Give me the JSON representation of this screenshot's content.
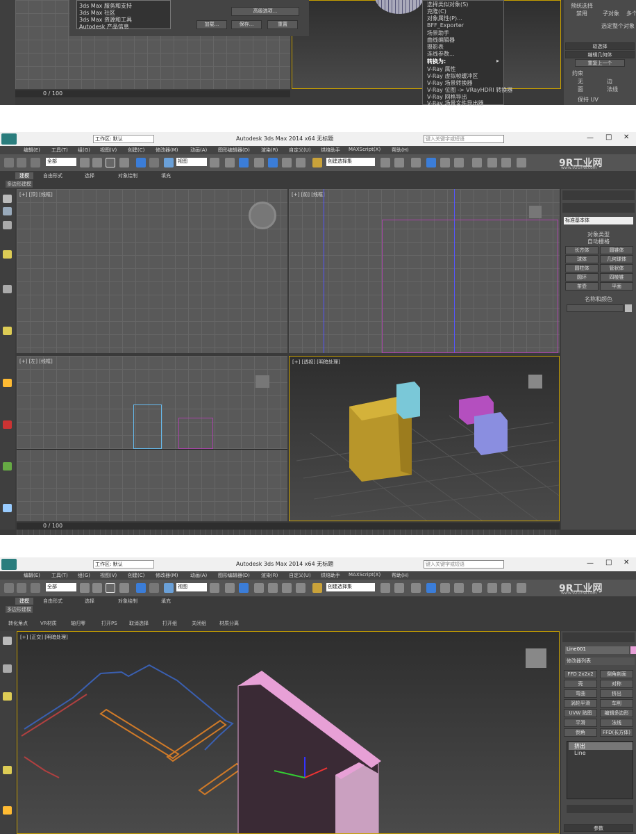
{
  "s1": {
    "dropdown_items": [
      "3ds Max 服务和支持",
      "3ds Max 社区",
      "3ds Max 资源和工具",
      "Autodesk 产品信息"
    ],
    "adv_option": "高级选项...",
    "load": "加载...",
    "save": "保存...",
    "reset": "重置",
    "context_items": [
      "选择类似对象(S)",
      "克隆(C)",
      "对象属性(P)...",
      "BFF_Exporter",
      "场景助手",
      "曲线编辑器",
      "摄影表",
      "连线参数...",
      "转换为:",
      "V-Ray 属性",
      "V-Ray 虚拟帧缓冲区",
      "V-Ray 场景转换器",
      "V-Ray 位图 -> VRayHDRI 转换器",
      "V-Ray 网格导出",
      "V-Ray 场景文件导出器"
    ],
    "preset_label": "预统选择",
    "radio_row": [
      "禁用",
      "子对象",
      "多个"
    ],
    "select_whole": "选定整个对象",
    "soft_select": "软选择",
    "edit_geom": "编辑几何体",
    "repeat_last": "重复上一个",
    "constraint": "约束",
    "constraint_opts": [
      "无",
      "边",
      "面",
      "法线"
    ],
    "keep_uv": "保持 UV",
    "timeline": "0 / 100"
  },
  "app": {
    "title": "Autodesk 3ds Max  2014 x64    无标题",
    "search_placeholder": "键入关键字或短语",
    "menus": [
      "编辑(E)",
      "工具(T)",
      "组(G)",
      "视图(V)",
      "创建(C)",
      "修改器(M)",
      "动画(A)",
      "图形编辑器(D)",
      "渲染(R)",
      "自定义(U)",
      "烘焙助手",
      "MAXScript(X)",
      "帮助(H)"
    ],
    "workspace": "工作区: 默认",
    "filter_all": "全部",
    "view_dd": "视图",
    "selset": "创建选择集",
    "watermark": "9R工业网",
    "watermark_url": "www.92GYW.com"
  },
  "s2": {
    "ribbon_tabs": [
      "建模",
      "自由形式",
      "选择",
      "对象绘制",
      "填充"
    ],
    "ribbon_sub": "多边形建模",
    "vp_top": "[+] [顶] [线框]",
    "vp_front": "[+] [前] [线框]",
    "vp_left": "[+] [左] [线框]",
    "vp_persp": "[+] [透视] [明暗处理]",
    "std_primitives": "标准基本体",
    "object_type": "对象类型",
    "autogrid": "自动栅格",
    "prims": [
      "长方体",
      "圆锥体",
      "球体",
      "几何球体",
      "圆柱体",
      "管状体",
      "圆环",
      "四棱锥",
      "茶壶",
      "平面"
    ],
    "name_color": "名称和颜色",
    "timeline": "0 / 100"
  },
  "s3": {
    "ribbon_tabs": [
      "建模",
      "自由形式",
      "选择",
      "对象绘制",
      "填充"
    ],
    "ribbon_sub": "多边形建模",
    "tools": [
      "转化角点",
      "VR材质",
      "轴归零",
      "打开PS",
      "取消选择",
      "打开组",
      "关闭组",
      "材质分离"
    ],
    "vp_label": "[+] [正交] [明暗处理]",
    "obj_name": "Line001",
    "modlist": "修改器列表",
    "mods": [
      "FFD 2x2x2",
      "倒角剖面",
      "壳",
      "对称",
      "弯曲",
      "挤出",
      "涡轮平滑",
      "车削",
      "UVW 贴图",
      "编辑多边形",
      "平滑",
      "法线",
      "倒角",
      "FFD(长方体)"
    ],
    "stack": [
      "挤出",
      "Line"
    ],
    "params": "参数"
  }
}
